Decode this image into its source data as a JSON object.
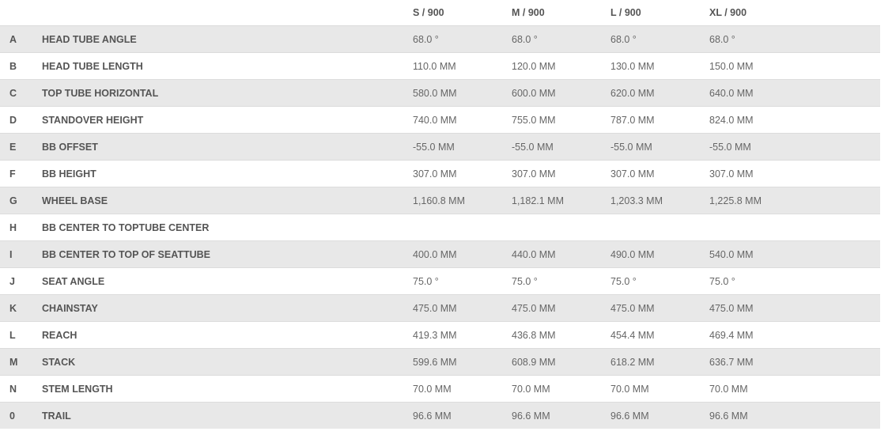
{
  "header": {
    "sizes": [
      "S / 900",
      "M / 900",
      "L / 900",
      "XL / 900"
    ]
  },
  "rows": [
    {
      "letter": "A",
      "label": "HEAD TUBE ANGLE",
      "values": [
        "68.0 °",
        "68.0 °",
        "68.0 °",
        "68.0 °"
      ]
    },
    {
      "letter": "B",
      "label": "HEAD TUBE LENGTH",
      "values": [
        "110.0 MM",
        "120.0 MM",
        "130.0 MM",
        "150.0 MM"
      ]
    },
    {
      "letter": "C",
      "label": "TOP TUBE HORIZONTAL",
      "values": [
        "580.0 MM",
        "600.0 MM",
        "620.0 MM",
        "640.0 MM"
      ]
    },
    {
      "letter": "D",
      "label": "STANDOVER HEIGHT",
      "values": [
        "740.0 MM",
        "755.0 MM",
        "787.0 MM",
        "824.0 MM"
      ]
    },
    {
      "letter": "E",
      "label": "BB OFFSET",
      "values": [
        "-55.0 MM",
        "-55.0 MM",
        "-55.0 MM",
        "-55.0 MM"
      ]
    },
    {
      "letter": "F",
      "label": "BB HEIGHT",
      "values": [
        "307.0 MM",
        "307.0 MM",
        "307.0 MM",
        "307.0 MM"
      ]
    },
    {
      "letter": "G",
      "label": "WHEEL BASE",
      "values": [
        "1,160.8 MM",
        "1,182.1 MM",
        "1,203.3 MM",
        "1,225.8 MM"
      ]
    },
    {
      "letter": "H",
      "label": "BB CENTER TO TOPTUBE CENTER",
      "values": [
        "",
        "",
        "",
        ""
      ]
    },
    {
      "letter": "I",
      "label": "BB CENTER TO TOP OF SEATTUBE",
      "values": [
        "400.0 MM",
        "440.0 MM",
        "490.0 MM",
        "540.0 MM"
      ]
    },
    {
      "letter": "J",
      "label": "SEAT ANGLE",
      "values": [
        "75.0 °",
        "75.0 °",
        "75.0 °",
        "75.0 °"
      ]
    },
    {
      "letter": "K",
      "label": "CHAINSTAY",
      "values": [
        "475.0 MM",
        "475.0 MM",
        "475.0 MM",
        "475.0 MM"
      ]
    },
    {
      "letter": "L",
      "label": "REACH",
      "values": [
        "419.3 MM",
        "436.8 MM",
        "454.4 MM",
        "469.4 MM"
      ]
    },
    {
      "letter": "M",
      "label": "STACK",
      "values": [
        "599.6 MM",
        "608.9 MM",
        "618.2 MM",
        "636.7 MM"
      ]
    },
    {
      "letter": "N",
      "label": "STEM LENGTH",
      "values": [
        "70.0 MM",
        "70.0 MM",
        "70.0 MM",
        "70.0 MM"
      ]
    },
    {
      "letter": "0",
      "label": "TRAIL",
      "values": [
        "96.6 MM",
        "96.6 MM",
        "96.6 MM",
        "96.6 MM"
      ]
    }
  ]
}
